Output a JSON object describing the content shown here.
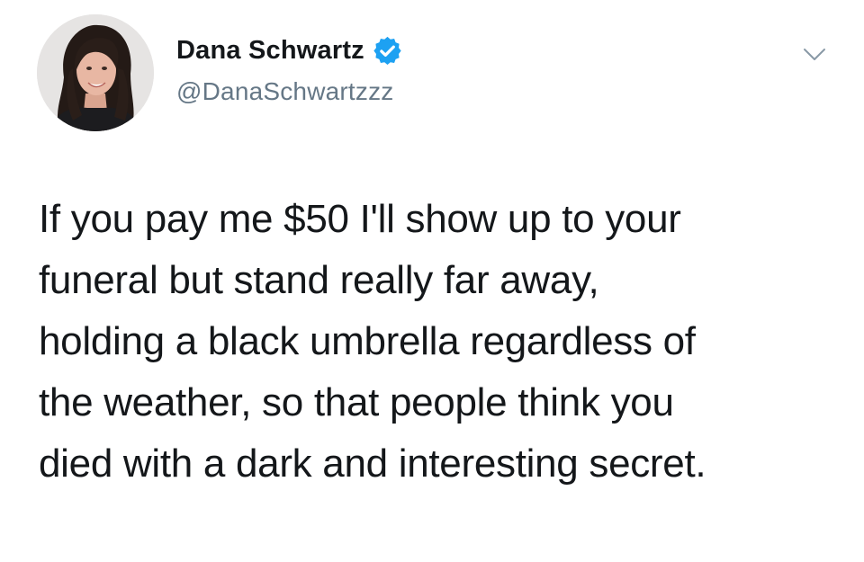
{
  "author": {
    "display_name": "Dana Schwartz",
    "handle": "@DanaSchwartzzz",
    "verified": true,
    "avatar_icon": "profile-photo",
    "verified_icon": "verified-badge-icon"
  },
  "menu": {
    "icon": "chevron-down-icon"
  },
  "tweet": {
    "lines": [
      "If you pay me $50 I'll show up to your",
      "funeral but stand really far away,",
      "holding a black umbrella regardless of",
      "the weather, so that people think you",
      "died with a dark and interesting secret."
    ]
  },
  "colors": {
    "text": "#14171a",
    "secondary_text": "#657786",
    "verified_blue": "#1da1f2",
    "background": "#ffffff"
  }
}
